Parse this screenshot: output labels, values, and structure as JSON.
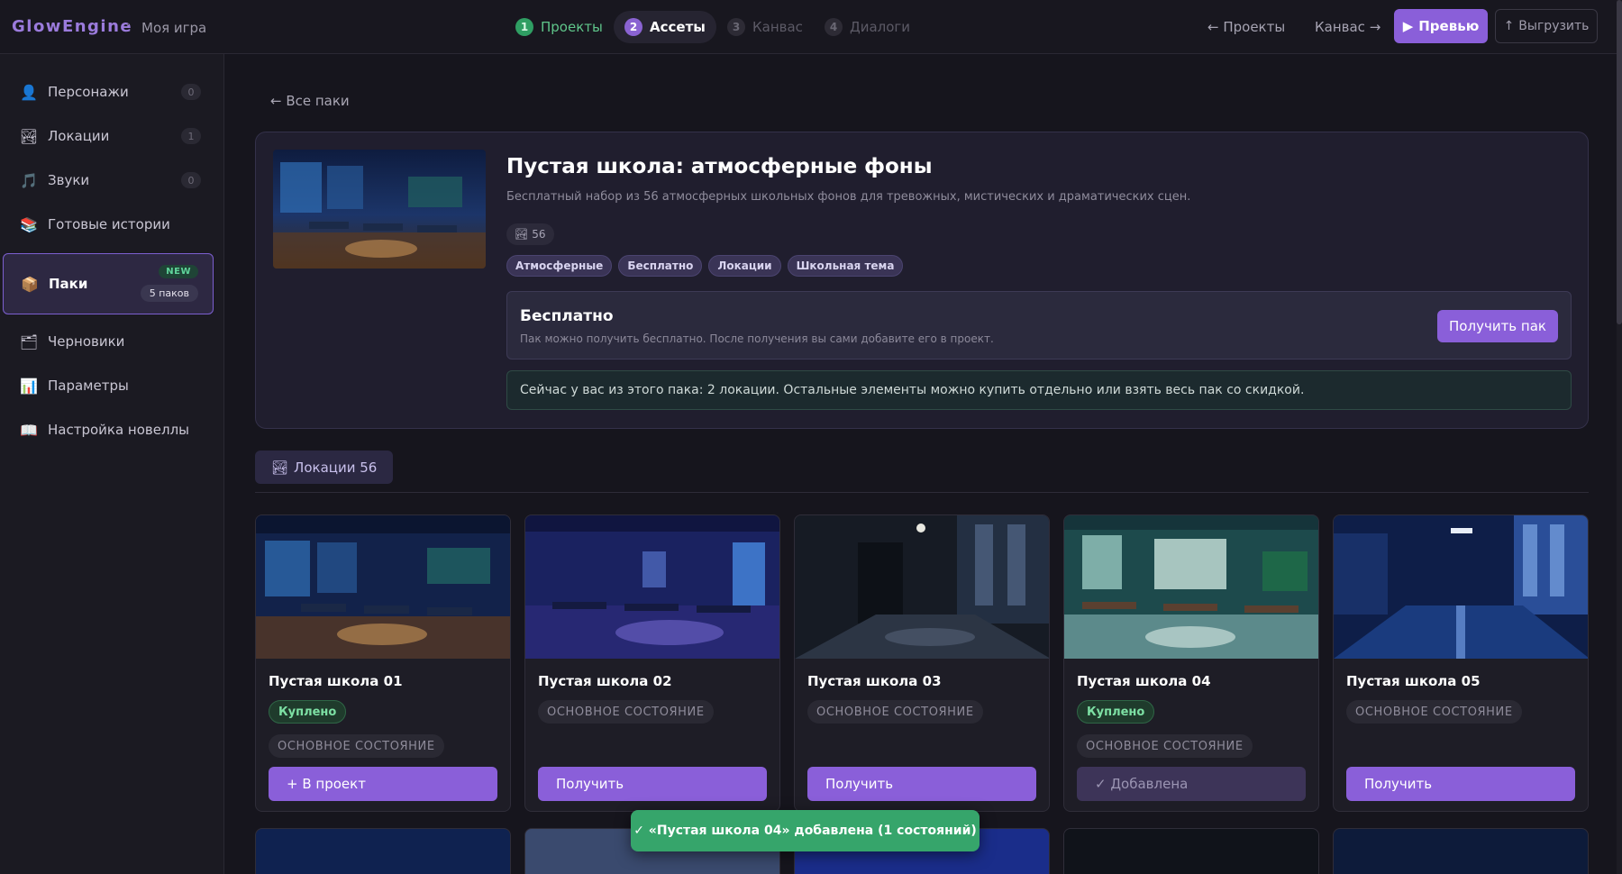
{
  "header": {
    "brand": "GlowEngine",
    "separator": "·",
    "project": "Моя игра",
    "steps": [
      {
        "num": "1",
        "label": "Проекты",
        "state": "done"
      },
      {
        "num": "2",
        "label": "Ассеты",
        "state": "active"
      },
      {
        "num": "3",
        "label": "Канвас",
        "state": "todo"
      },
      {
        "num": "4",
        "label": "Диалоги",
        "state": "todo"
      }
    ],
    "back_projects": "← Проекты",
    "forward_canvas": "Канвас →",
    "preview_icon": "▶",
    "preview_label": "Превью",
    "export_icon": "↑",
    "export_label": "Выгрузить"
  },
  "sidebar": {
    "items": [
      {
        "label": "Персонажи",
        "count": "0",
        "icon": "person-icon",
        "glyph": "👤"
      },
      {
        "label": "Локации",
        "count": "1",
        "icon": "location-icon",
        "glyph": "🏞"
      },
      {
        "label": "Звуки",
        "count": "0",
        "icon": "music-icon",
        "glyph": "🎵"
      },
      {
        "label": "Готовые истории",
        "icon": "stories-icon",
        "glyph": "📚"
      },
      {
        "label": "Паки",
        "icon": "package-icon",
        "glyph": "📦",
        "badge_new": "NEW",
        "badge_count": "5 паков"
      },
      {
        "label": "Черновики",
        "icon": "drafts-icon",
        "glyph": "🗂"
      },
      {
        "label": "Параметры",
        "icon": "chart-icon",
        "glyph": "📊"
      },
      {
        "label": "Настройка новеллы",
        "icon": "book-icon",
        "glyph": "📖"
      }
    ]
  },
  "main": {
    "back_link": "← Все паки",
    "pack": {
      "title": "Пустая школа: атмосферные фоны",
      "description": "Бесплатный набор из 56 атмосферных школьных фонов для тревожных, мистических и драматических сцен.",
      "count": "56",
      "tags": [
        "Атмосферные",
        "Бесплатно",
        "Локации",
        "Школьная тема"
      ],
      "price_title": "Бесплатно",
      "price_note": "Пак можно получить бесплатно. После получения вы сами добавите его в проект.",
      "get_button": "Получить пак",
      "info": "Сейчас у вас из этого пака: 2 локации. Остальные элементы можно купить отдельно или взять весь пак со скидкой."
    },
    "section_tab": "Локации 56",
    "cards": [
      {
        "title": "Пустая школа 01",
        "bought": "Куплено",
        "state": "ОСНОВНОЕ СОСТОЯНИЕ",
        "button": "+ В проект",
        "button_state": "primary"
      },
      {
        "title": "Пустая школа 02",
        "state": "ОСНОВНОЕ СОСТОЯНИЕ",
        "button": "Получить",
        "button_state": "primary"
      },
      {
        "title": "Пустая школа 03",
        "state": "ОСНОВНОЕ СОСТОЯНИЕ",
        "button": "Получить",
        "button_state": "primary"
      },
      {
        "title": "Пустая школа 04",
        "bought": "Куплено",
        "state": "ОСНОВНОЕ СОСТОЯНИЕ",
        "button": "✓ Добавлена",
        "button_state": "added"
      },
      {
        "title": "Пустая школа 05",
        "state": "ОСНОВНОЕ СОСТОЯНИЕ",
        "button": "Получить",
        "button_state": "primary"
      }
    ],
    "toast": "✓ «Пустая школа 04» добавлена (1 состояний)"
  },
  "colors": {
    "accent": "#8a5fd9",
    "success": "#36a56b",
    "background": "#16151d"
  }
}
